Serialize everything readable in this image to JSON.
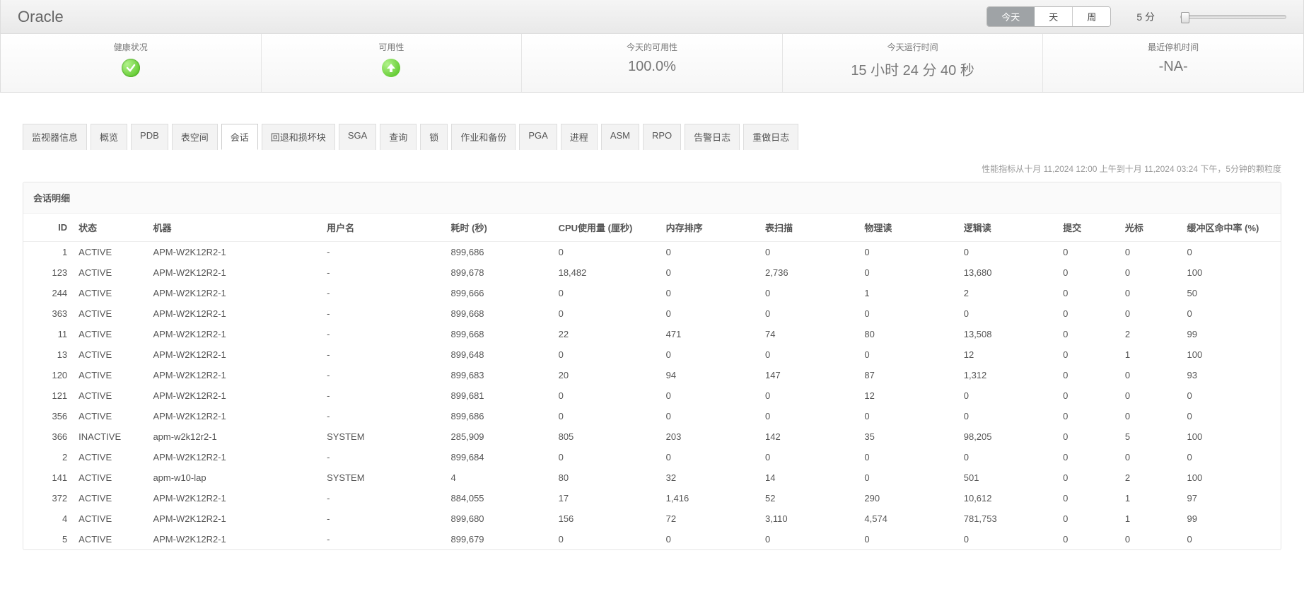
{
  "title": "Oracle",
  "time_tabs": {
    "items": [
      "今天",
      "天",
      "周"
    ],
    "active": 0,
    "granularity": "5 分"
  },
  "metrics": {
    "health": {
      "label": "健康状况",
      "icon": "check"
    },
    "availability": {
      "label": "可用性",
      "icon": "up"
    },
    "today_avail": {
      "label": "今天的可用性",
      "value": "100.0%"
    },
    "uptime": {
      "label": "今天运行时间",
      "value": "15 小时 24 分 40 秒"
    },
    "downtime": {
      "label": "最近停机时间",
      "value": "-NA-"
    }
  },
  "tabs": {
    "items": [
      "监视器信息",
      "概览",
      "PDB",
      "表空间",
      "会话",
      "回退和损坏块",
      "SGA",
      "查询",
      "锁",
      "作业和备份",
      "PGA",
      "进程",
      "ASM",
      "RPO",
      "告警日志",
      "重做日志"
    ],
    "active": 4
  },
  "meta_line": "性能指标从十月 11,2024 12:00 上午到十月 11,2024 03:24 下午，5分钟的颗粒度",
  "table": {
    "title": "会话明细",
    "columns": [
      "ID",
      "状态",
      "机器",
      "用户名",
      "耗时 (秒)",
      "CPU使用量 (厘秒)",
      "内存排序",
      "表扫描",
      "物理读",
      "逻辑读",
      "提交",
      "光标",
      "缓冲区命中率 (%)"
    ],
    "rows": [
      [
        "1",
        "ACTIVE",
        "APM-W2K12R2-1",
        "-",
        "899,686",
        "0",
        "0",
        "0",
        "0",
        "0",
        "0",
        "0",
        "0"
      ],
      [
        "123",
        "ACTIVE",
        "APM-W2K12R2-1",
        "-",
        "899,678",
        "18,482",
        "0",
        "2,736",
        "0",
        "13,680",
        "0",
        "0",
        "100"
      ],
      [
        "244",
        "ACTIVE",
        "APM-W2K12R2-1",
        "-",
        "899,666",
        "0",
        "0",
        "0",
        "1",
        "2",
        "0",
        "0",
        "50"
      ],
      [
        "363",
        "ACTIVE",
        "APM-W2K12R2-1",
        "-",
        "899,668",
        "0",
        "0",
        "0",
        "0",
        "0",
        "0",
        "0",
        "0"
      ],
      [
        "11",
        "ACTIVE",
        "APM-W2K12R2-1",
        "-",
        "899,668",
        "22",
        "471",
        "74",
        "80",
        "13,508",
        "0",
        "2",
        "99"
      ],
      [
        "13",
        "ACTIVE",
        "APM-W2K12R2-1",
        "-",
        "899,648",
        "0",
        "0",
        "0",
        "0",
        "12",
        "0",
        "1",
        "100"
      ],
      [
        "120",
        "ACTIVE",
        "APM-W2K12R2-1",
        "-",
        "899,683",
        "20",
        "94",
        "147",
        "87",
        "1,312",
        "0",
        "0",
        "93"
      ],
      [
        "121",
        "ACTIVE",
        "APM-W2K12R2-1",
        "-",
        "899,681",
        "0",
        "0",
        "0",
        "12",
        "0",
        "0",
        "0",
        "0"
      ],
      [
        "356",
        "ACTIVE",
        "APM-W2K12R2-1",
        "-",
        "899,686",
        "0",
        "0",
        "0",
        "0",
        "0",
        "0",
        "0",
        "0"
      ],
      [
        "366",
        "INACTIVE",
        "apm-w2k12r2-1",
        "SYSTEM",
        "285,909",
        "805",
        "203",
        "142",
        "35",
        "98,205",
        "0",
        "5",
        "100"
      ],
      [
        "2",
        "ACTIVE",
        "APM-W2K12R2-1",
        "-",
        "899,684",
        "0",
        "0",
        "0",
        "0",
        "0",
        "0",
        "0",
        "0"
      ],
      [
        "141",
        "ACTIVE",
        "apm-w10-lap",
        "SYSTEM",
        "4",
        "80",
        "32",
        "14",
        "0",
        "501",
        "0",
        "2",
        "100"
      ],
      [
        "372",
        "ACTIVE",
        "APM-W2K12R2-1",
        "-",
        "884,055",
        "17",
        "1,416",
        "52",
        "290",
        "10,612",
        "0",
        "1",
        "97"
      ],
      [
        "4",
        "ACTIVE",
        "APM-W2K12R2-1",
        "-",
        "899,680",
        "156",
        "72",
        "3,110",
        "4,574",
        "781,753",
        "0",
        "1",
        "99"
      ],
      [
        "5",
        "ACTIVE",
        "APM-W2K12R2-1",
        "-",
        "899,679",
        "0",
        "0",
        "0",
        "0",
        "0",
        "0",
        "0",
        "0"
      ]
    ]
  }
}
